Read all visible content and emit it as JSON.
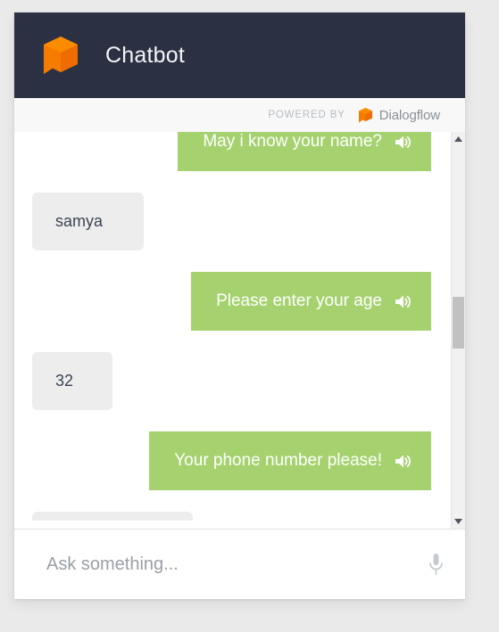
{
  "header": {
    "title": "Chatbot",
    "logo_icon": "dialogflow-cube-icon",
    "background_color": "#2b3142"
  },
  "powered_by": {
    "label": "POWERED BY",
    "brand": "Dialogflow",
    "brand_icon": "dialogflow-cube-icon",
    "brand_color": "#f57c00"
  },
  "colors": {
    "bot_bubble": "#a5d26e",
    "user_bubble": "#ededed",
    "bot_text": "#ffffff",
    "user_text": "#3b4452",
    "page_background": "#e9eae9",
    "card_background": "#ffffff"
  },
  "conversation": {
    "messages": [
      {
        "sender": "bot",
        "text": "May i know your name?",
        "has_speaker": true,
        "clipped": true
      },
      {
        "sender": "user",
        "text": "samya",
        "has_speaker": false,
        "clipped": false
      },
      {
        "sender": "bot",
        "text": "Please enter your age",
        "has_speaker": true,
        "clipped": false
      },
      {
        "sender": "user",
        "text": "32",
        "has_speaker": false,
        "clipped": false
      },
      {
        "sender": "bot",
        "text": "Your phone number please!",
        "has_speaker": true,
        "clipped": false
      },
      {
        "sender": "user",
        "text": "",
        "has_speaker": false,
        "clipped": true
      }
    ]
  },
  "scrollbar": {
    "up_arrow_icon": "triangle-up-icon",
    "down_arrow_icon": "triangle-down-icon",
    "thumb_position_percent": 41
  },
  "composer": {
    "placeholder": "Ask something...",
    "value": "",
    "mic_icon": "microphone-icon"
  }
}
